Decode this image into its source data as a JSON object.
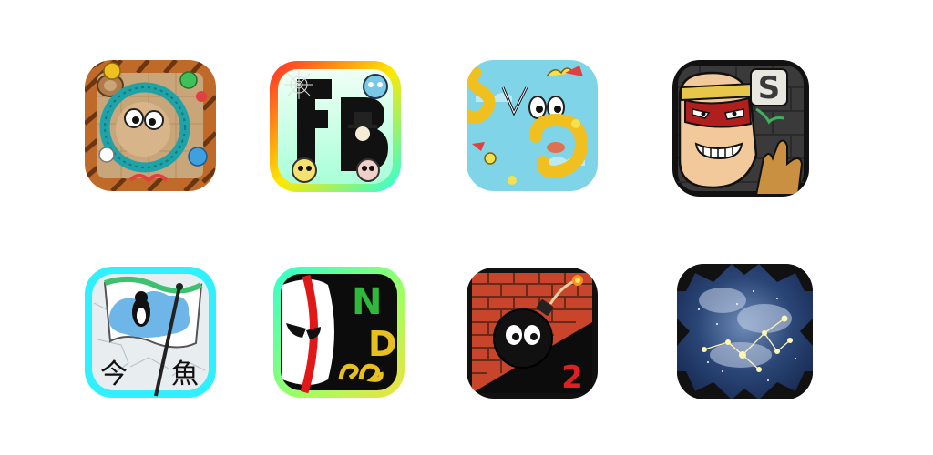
{
  "apps": [
    {
      "id": "button-rope-game",
      "icon_colors": {
        "border": "#c06a2a",
        "burlap": "#c9a57a",
        "rope": "#1fa3a8",
        "bear": "#b07a4a"
      }
    },
    {
      "id": "fb-letters-game",
      "letters": [
        "F",
        "B"
      ],
      "icon_colors": {
        "ring_start": "#ff2b2b",
        "ring_mid": "#ffe800",
        "ring_end": "#2bffe0",
        "inner": "#d8ffe8"
      }
    },
    {
      "id": "syoo-game",
      "letters": [
        "S",
        "y",
        "o",
        "o"
      ],
      "icon_colors": {
        "sky": "#7fd4e8",
        "creature": "#f5e14a",
        "letter": "#f0c020"
      }
    },
    {
      "id": "ninja-wall-game",
      "letters": [
        "S"
      ],
      "icon_colors": {
        "wall": "#3a3a3a",
        "skin": "#f2c99a",
        "band": "#e8c64a",
        "mask": "#b01e1e"
      }
    },
    {
      "id": "penguin-flag-game",
      "kanji": [
        "今",
        "魚"
      ],
      "icon_colors": {
        "ring": "#30f0ff",
        "ice": "#e8eef0",
        "flag": "#ffffff",
        "cloud": "#6fb6e8"
      }
    },
    {
      "id": "nd-face-game",
      "letters": [
        "N",
        "D"
      ],
      "icon_colors": {
        "ring_start": "#30ffd0",
        "ring_end": "#f0e040",
        "mask": "#ffffff",
        "stripe": "#e01818",
        "letter_n": "#2fb83a",
        "letter_d": "#e6c020"
      }
    },
    {
      "id": "bomb-brick-game",
      "number": "2",
      "icon_colors": {
        "brick": "#c8442a",
        "mortar": "#6a2a1a",
        "bomb": "#111111",
        "number": "#e02020"
      }
    },
    {
      "id": "constellation-game",
      "icon_colors": {
        "sky": "#1e3560",
        "star": "#fff6b0",
        "frame": "#111111"
      }
    }
  ]
}
